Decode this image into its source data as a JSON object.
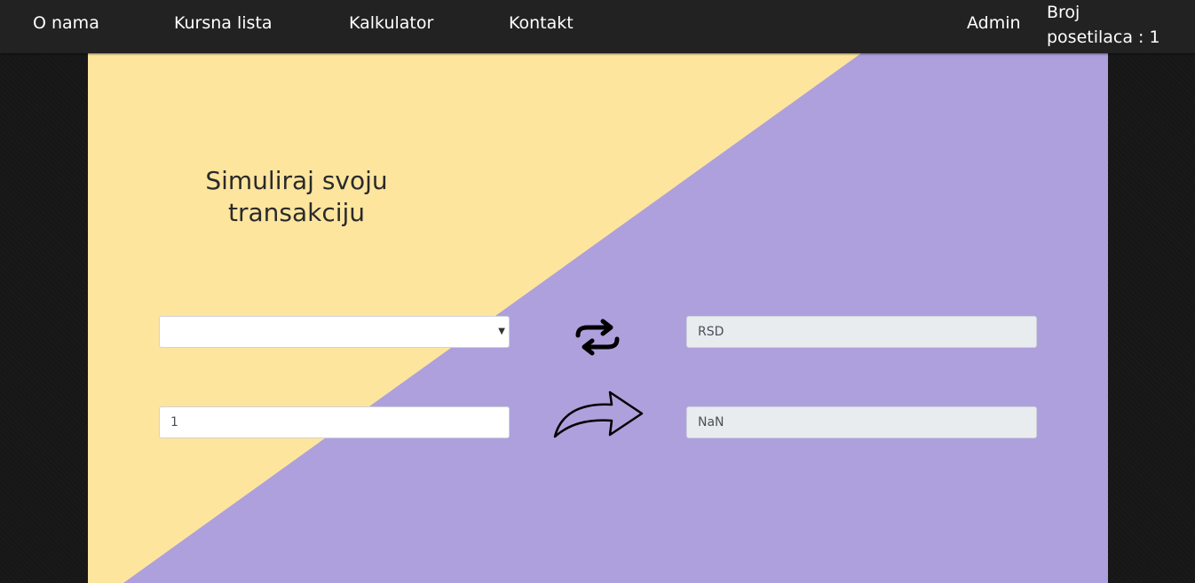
{
  "nav": {
    "links": [
      "O nama",
      "Kursna lista",
      "Kalkulator",
      "Kontakt"
    ],
    "admin": "Admin",
    "counter_line1": "Broj",
    "counter_line2": "posetilaca : 1"
  },
  "converter": {
    "heading_line1": "Simuliraj svoju",
    "heading_line2": "transakciju",
    "from_currency_selected": "",
    "amount_value": "1",
    "to_currency_value": "RSD",
    "result_value": "NaN"
  },
  "icons": {
    "swap": "swap-arrows-icon",
    "convert": "curved-arrow-right-icon"
  },
  "colors": {
    "navbar": "#232223",
    "yellow_area": "#fde59e",
    "purple_area": "#aea0dc",
    "page_background": "#161616"
  }
}
